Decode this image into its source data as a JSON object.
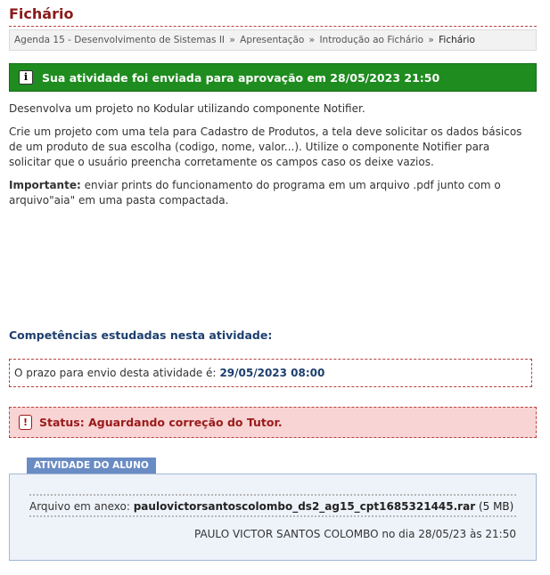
{
  "page": {
    "title": "Fichário"
  },
  "breadcrumb": {
    "items": [
      "Agenda 15 - Desenvolvimento de Sistemas II",
      "Apresentação",
      "Introdução ao Fichário",
      "Fichário"
    ],
    "separator": "»"
  },
  "success_message": {
    "icon": "info-icon",
    "text": "Sua atividade foi enviada para aprovação em 28/05/2023 21:50",
    "color": "#1f8c1f"
  },
  "description": {
    "p1": "Desenvolva um projeto no Kodular utilizando componente Notifier.",
    "p2": "Crie um projeto com uma tela para Cadastro de Produtos, a tela deve solicitar os dados básicos de um produto de sua escolha (codigo, nome, valor...). Utilize o componente Notifier para solicitar que o usuário preencha corretamente os campos caso os deixe vazios.",
    "important_label": "Importante:",
    "important_text": " enviar prints do funcionamento do programa em um arquivo .pdf junto com o arquivo\"aia\" em uma pasta compactada."
  },
  "competencias": {
    "title": "Competências estudadas nesta atividade:"
  },
  "deadline": {
    "label": "O prazo para envio desta atividade é:",
    "date": "29/05/2023 08:00"
  },
  "status": {
    "icon": "warning-icon",
    "text": "Status: Aguardando correção do Tutor.",
    "color": "#f8d4d4"
  },
  "student_activity": {
    "tab_label": "ATIVIDADE DO ALUNO",
    "attachment_label": "Arquivo em anexo:",
    "filename": "paulovictorsantoscolombo_ds2_ag15_cpt1685321445.rar",
    "size": "(5 MB)",
    "author_line": "PAULO VICTOR SANTOS COLOMBO no dia 28/05/23 às 21:50"
  }
}
